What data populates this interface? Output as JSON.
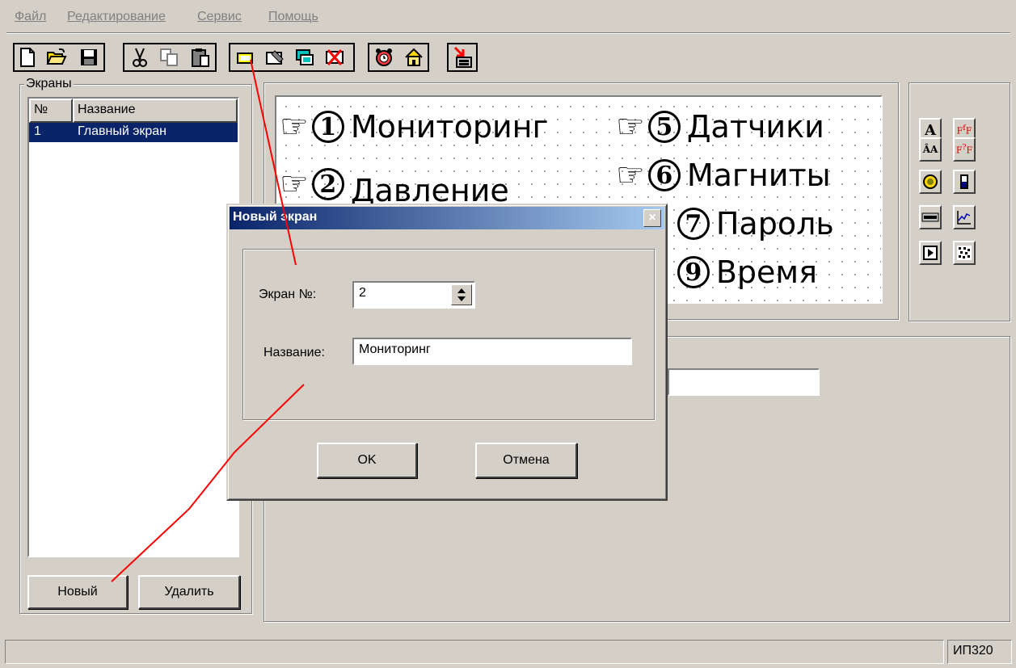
{
  "menu": {
    "items": [
      "Файл",
      "Редактирование",
      "Сервис",
      "Помощь"
    ]
  },
  "toolbar": {
    "icons": [
      "new-file-icon",
      "open-folder-icon",
      "save-icon",
      "cut-icon",
      "copy-icon",
      "paste-icon",
      "new-screen-icon",
      "screen-properties-icon",
      "copy-screen-icon",
      "delete-screen-icon",
      "alarm-icon",
      "home-icon",
      "export-icon"
    ]
  },
  "screens_panel": {
    "label": "Экраны",
    "col_num": "№",
    "col_name": "Название",
    "rows": [
      {
        "num": "1",
        "name": "Главный экран"
      }
    ],
    "new_button": "Новый",
    "delete_button": "Удалить"
  },
  "preview": {
    "lines": [
      {
        "num": "1",
        "label": "Мониторинг"
      },
      {
        "num": "2",
        "label": "Давление"
      },
      {
        "num": "5",
        "label": "Датчики"
      },
      {
        "num": "6",
        "label": "Магниты"
      },
      {
        "num": "7",
        "label": "Пароль"
      },
      {
        "num": "9",
        "label": "Время"
      }
    ],
    "hand_glyph": "☞"
  },
  "dialog": {
    "title": "Новый экран",
    "close_glyph": "×",
    "screen_num_label": "Экран №:",
    "screen_num_value": "2",
    "name_label": "Название:",
    "name_value": "Мониторинг",
    "ok_label": "OK",
    "cancel_label": "Отмена"
  },
  "status": {
    "right_text": "ИП320"
  },
  "colors": {
    "window_bg": "#d4d0c8",
    "selection": "#0a246a",
    "annotation": "#ff0000"
  }
}
